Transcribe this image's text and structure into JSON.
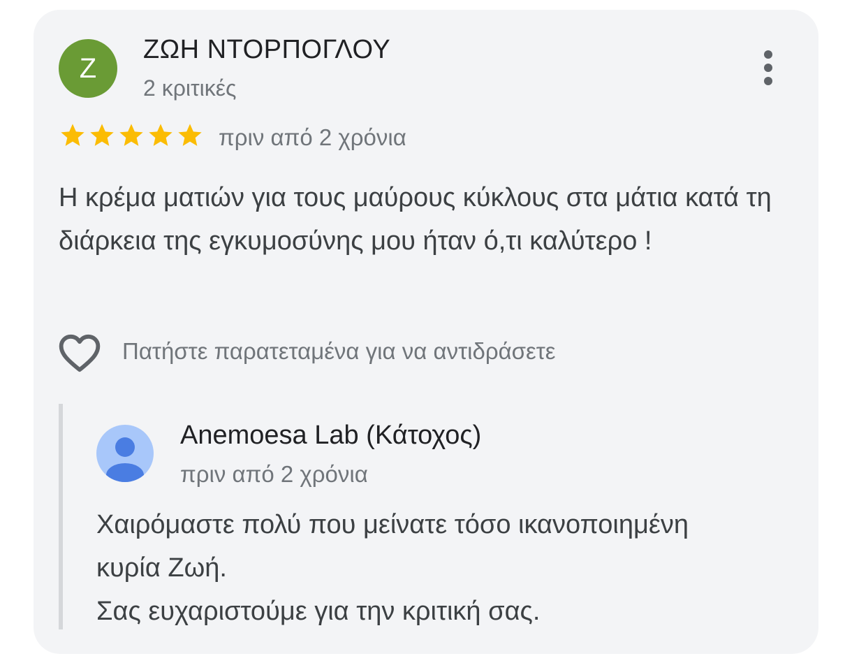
{
  "review": {
    "author_initial": "Z",
    "author_name": "ΖΩΗ ΝΤΟΡΠΟΓΛΟΥ",
    "review_count": "2 κριτικές",
    "rating": 5,
    "max_rating": 5,
    "time": "πριν από 2 χρόνια",
    "text": "Η κρέμα ματιών για τους μαύρους κύκλους στα μάτια κατά τη διάρκεια της εγκυμοσύνης μου ήταν ό,τι καλύτερο !",
    "react_hint": "Πατήστε παρατεταμένα για να αντιδράσετε"
  },
  "owner_reply": {
    "name": "Anemoesa Lab (Κάτοχος)",
    "time": "πριν από 2 χρόνια",
    "lines": [
      "Χαιρόμαστε πολύ που μείνατε τόσο ικανοποιημένη",
      "κυρία Ζωή.",
      "Σας ευχαριστούμε για την κριτική σας."
    ]
  },
  "colors": {
    "avatar": "#6a9b35",
    "star": "#fbbc04",
    "owner_avatar_bg": "#a8c7fa",
    "owner_avatar_fg": "#4a7de2"
  },
  "icons": {
    "more": "more-vert-icon",
    "heart": "heart-outline-icon",
    "star": "star-icon",
    "person": "person-icon"
  }
}
